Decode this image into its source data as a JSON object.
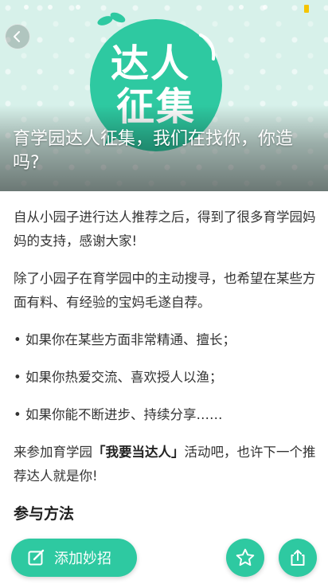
{
  "hero": {
    "badge_line1": "达人",
    "badge_line2": "征集",
    "title": "育学园达人征集，我们在找你，你造吗?"
  },
  "article": {
    "paragraphs": [
      "自从小园子进行达人推荐之后，得到了很多育学园妈妈的支持，感谢大家!",
      "除了小园子在育学园中的主动搜寻，也希望在某些方面有料、有经验的宝妈毛遂自荐。",
      "• 如果你在某些方面非常精通、擅长；",
      "• 如果你热爱交流、喜欢授人以渔；",
      "• 如果你能不断进步、持续分享……"
    ],
    "cta_before": "来参加育学园",
    "cta_highlight": "「我要当达人」",
    "cta_after": "活动吧，也许下一个推荐达人就是你!",
    "section_title": "参与方法"
  },
  "actions": {
    "add_label": "添加妙招",
    "favorite_icon": "star-icon",
    "share_icon": "share-icon"
  },
  "icons": {
    "back": "chevron-left-icon",
    "edit": "edit-icon"
  },
  "colors": {
    "accent": "#2ec9a1",
    "hero_background": "#d7f1ea",
    "battery": "#f5c400"
  }
}
